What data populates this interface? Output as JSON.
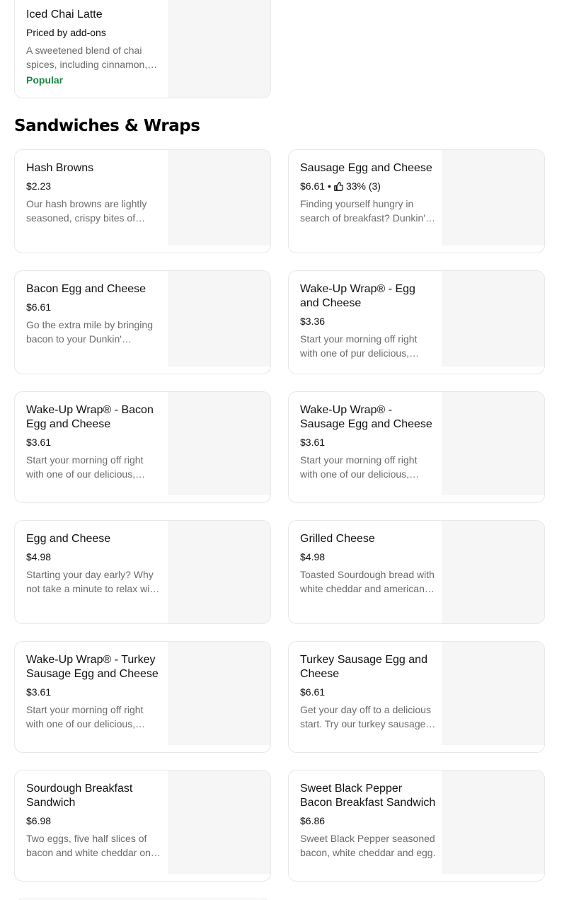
{
  "top_item": {
    "name": "Iced Chai Latte",
    "price": "Priced by add-ons",
    "description": "A sweetened blend of chai spices, including cinnamon, cardamom, ginger and clove, paired with smooth milk and ice.",
    "badge": "Popular"
  },
  "section": {
    "title": "Sandwiches & Wraps"
  },
  "items": [
    {
      "name": "Hash Browns",
      "price": "$2.23",
      "description": "Our hash browns are lightly seasoned, crispy bites of golden potato goodness."
    },
    {
      "name": "Sausage Egg and Cheese",
      "price": "$6.61",
      "rating_sep": "•",
      "rating": "33% (3)",
      "description": "Finding yourself hungry in search of breakfast? Dunkin' has you covered."
    },
    {
      "name": "Bacon Egg and Cheese",
      "price": "$6.61",
      "description": "Go the extra mile by bringing bacon to your Dunkin' breakfast sandwich."
    },
    {
      "name": "Wake-Up Wrap® - Egg and Cheese",
      "price": "$3.36",
      "description": "Start your morning off right with one of pur delicious, protein-packed wraps."
    },
    {
      "name": "Wake-Up Wrap® - Bacon Egg and Cheese",
      "price": "$3.61",
      "description": "Start your morning off right with one of our delicious, protein-packed wraps."
    },
    {
      "name": "Wake-Up Wrap® - Sausage Egg and Cheese",
      "price": "$3.61",
      "description": "Start your morning off right with one of our delicious, protein-packed wraps."
    },
    {
      "name": "Egg and Cheese",
      "price": "$4.98",
      "description": "Starting your day early? Why not take a minute to relax with our classic sandwich."
    },
    {
      "name": "Grilled Cheese",
      "price": "$4.98",
      "description": "Toasted Sourdough bread with white cheddar and american cheese."
    },
    {
      "name": "Wake-Up Wrap® - Turkey Sausage Egg and Cheese",
      "price": "$3.61",
      "description": "Start your morning off right with one of our delicious, protein-packed wraps."
    },
    {
      "name": "Turkey Sausage Egg and Cheese",
      "price": "$6.61",
      "description": "Get your day off to a delicious start. Try our turkey sausage sandwich."
    },
    {
      "name": "Sourdough Breakfast Sandwich",
      "price": "$6.98",
      "description": "Two eggs, five half slices of bacon and white cheddar on sourdough bread."
    },
    {
      "name": "Sweet Black Pepper Bacon Breakfast Sandwich",
      "price": "$6.86",
      "description": "Sweet Black Pepper seasoned bacon, white cheddar and egg."
    }
  ]
}
